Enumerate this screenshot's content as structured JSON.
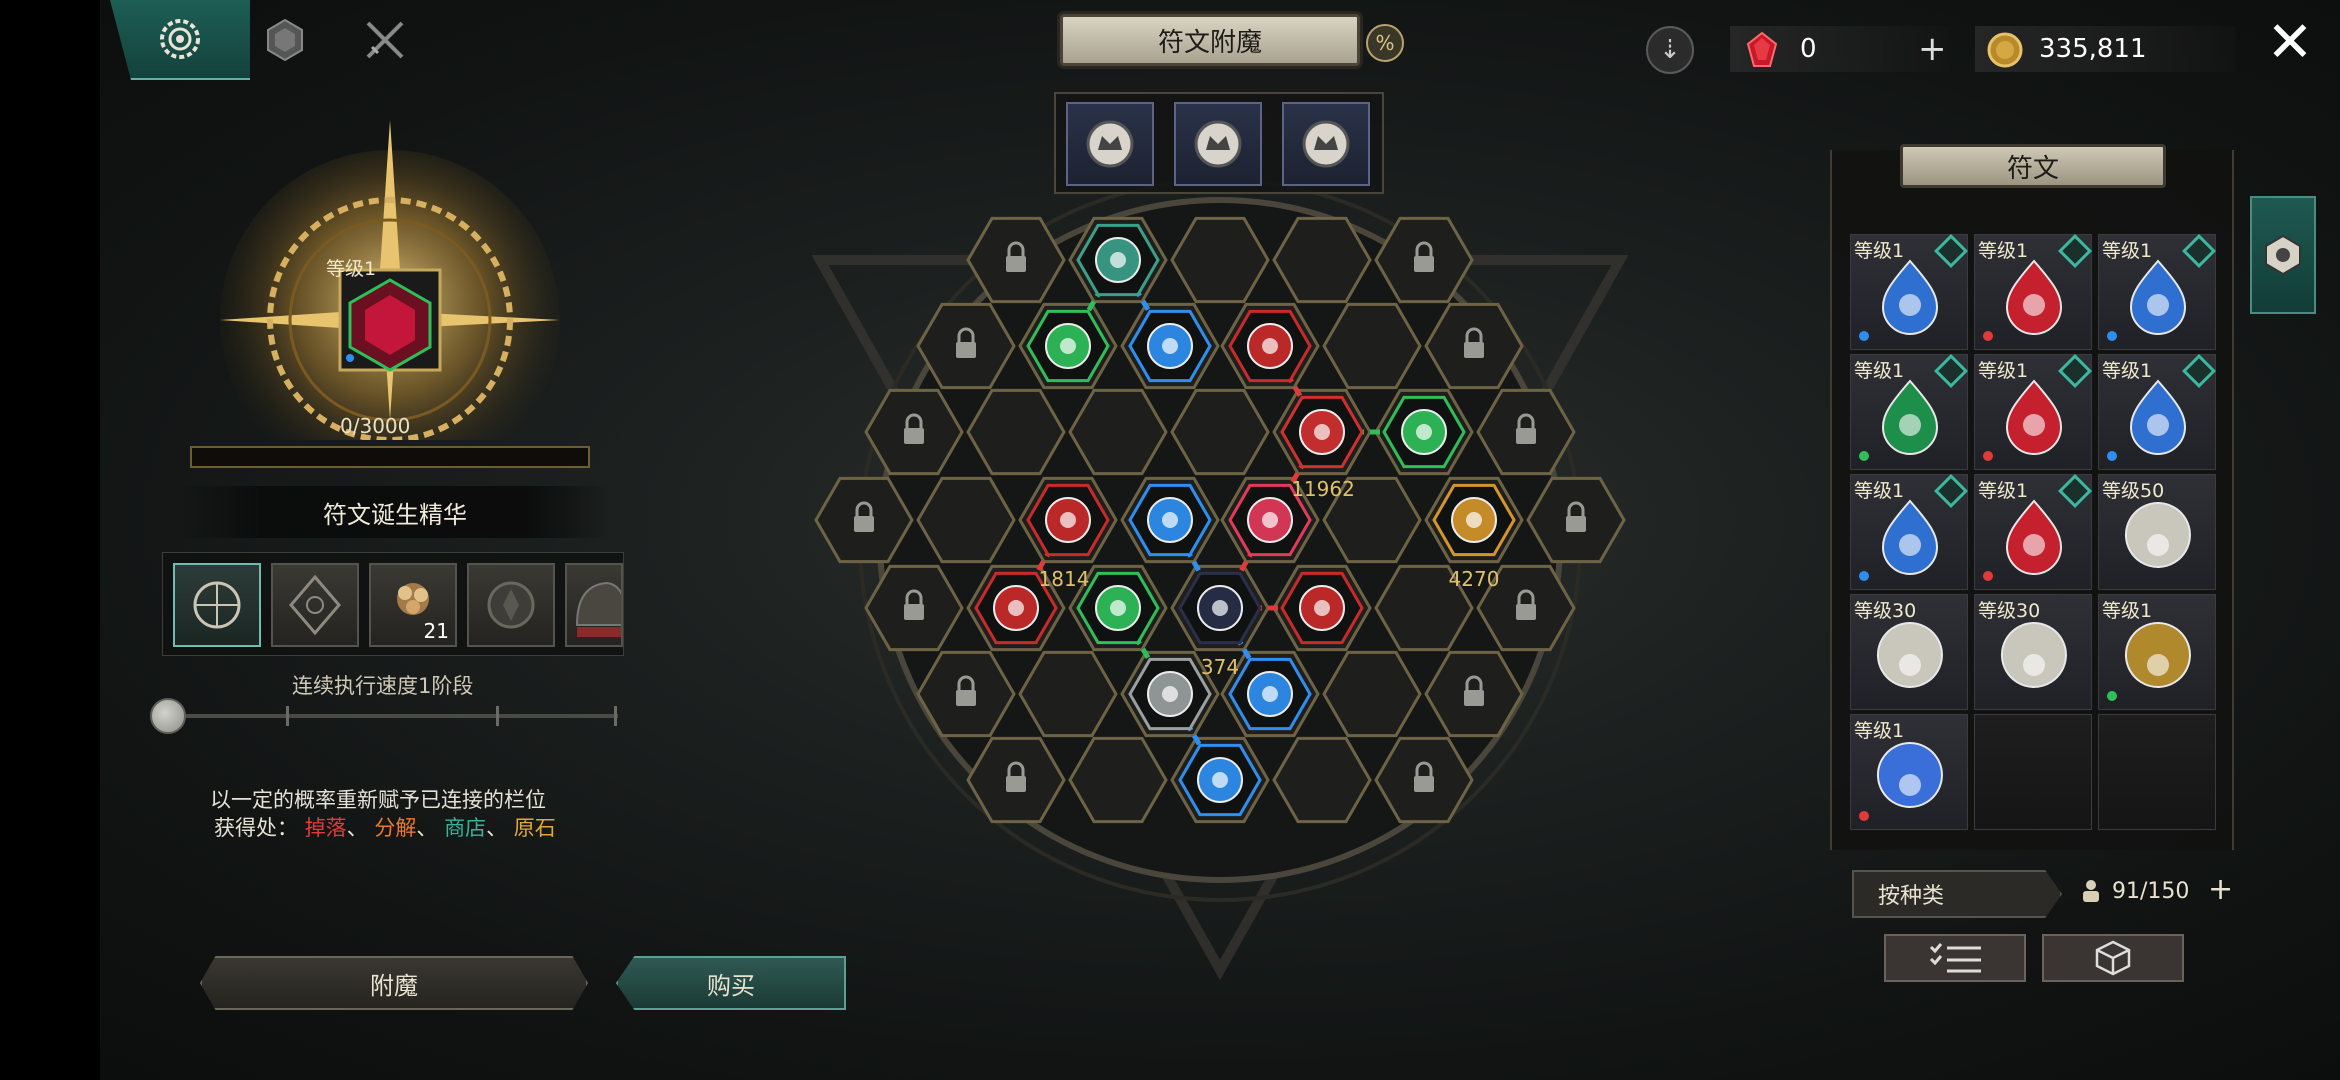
{
  "header": {
    "title": "符文附魔",
    "percent_icon": "%",
    "gem_count": "0",
    "gold_count": "335,811",
    "close_icon": "✕"
  },
  "tabs": [
    {
      "name": "rune-tab",
      "icon": "gear-rune-icon",
      "active": true
    },
    {
      "name": "gem-tab",
      "icon": "hexagon-gem-icon",
      "active": false
    },
    {
      "name": "sword-tab",
      "icon": "crossed-swords-icon",
      "active": false
    }
  ],
  "essence": {
    "level_label": "等级1",
    "progress_text": "0/3000",
    "progress": 0,
    "name": "符文诞生精华"
  },
  "materials": [
    {
      "icon": "rune-sigil-icon",
      "count": "",
      "selected": true
    },
    {
      "icon": "geometric-rune-icon",
      "count": "",
      "selected": false
    },
    {
      "icon": "flower-ore-icon",
      "count": "21",
      "selected": false
    },
    {
      "icon": "dark-stone-icon",
      "count": "",
      "selected": false
    },
    {
      "icon": "helmet-icon",
      "count": "",
      "selected": false
    }
  ],
  "speed": {
    "label": "连续执行速度1阶段",
    "stage": 1,
    "stages": 4
  },
  "description": {
    "line1": "以一定的概率重新赋予已连接的栏位",
    "line2_prefix": "获得处：",
    "src_drop": "掉落",
    "sep": "、",
    "src_dismantle": "分解",
    "src_shop": "商店",
    "src_ore": "原石"
  },
  "buttons": {
    "enchant": "附魔",
    "buy": "购买"
  },
  "board": {
    "values": [
      "11962",
      "1814",
      "4270",
      "374"
    ],
    "top_slots": [
      "crown-rune-icon",
      "crown-rune-icon",
      "crown-rune-icon"
    ]
  },
  "rune_panel": {
    "title": "符文",
    "sort_label": "按种类",
    "capacity": "91/150",
    "items": [
      {
        "level": "等级1",
        "icon": "blue-gear-drop-icon",
        "dot": "#2f8ff0"
      },
      {
        "level": "等级1",
        "icon": "red-burst-drop-icon",
        "dot": "#e23a3a"
      },
      {
        "level": "等级1",
        "icon": "blue-moon-drop-icon",
        "dot": "#2f8ff0"
      },
      {
        "level": "等级1",
        "icon": "green-hourglass-drop-icon",
        "dot": "#2fbf5a"
      },
      {
        "level": "等级1",
        "icon": "red-crown-drop-icon",
        "dot": "#e23a3a"
      },
      {
        "level": "等级1",
        "icon": "blue-dots-drop-icon",
        "dot": "#2f8ff0"
      },
      {
        "level": "等级1",
        "icon": "blue-swirl-drop-icon",
        "dot": "#2f8ff0"
      },
      {
        "level": "等级1",
        "icon": "red-sword-drop-icon",
        "dot": "#e23a3a"
      },
      {
        "level": "等级50",
        "icon": "silver-crown-rune-icon",
        "dot": ""
      },
      {
        "level": "等级30",
        "icon": "silver-crown-rune-icon",
        "dot": ""
      },
      {
        "level": "等级30",
        "icon": "silver-maze-rune-icon",
        "dot": ""
      },
      {
        "level": "等级1",
        "icon": "gold-weapon-rune-icon",
        "dot": "#2fbf5a"
      },
      {
        "level": "等级1",
        "icon": "lightning-orb-rune-icon",
        "dot": "#e23a3a"
      }
    ]
  },
  "colors": {
    "accent_teal": "#1d5e55",
    "gold": "#d9b45a",
    "red_link": "#e23a3a",
    "blue_link": "#2f8ff0",
    "green_link": "#2fbf5a"
  }
}
